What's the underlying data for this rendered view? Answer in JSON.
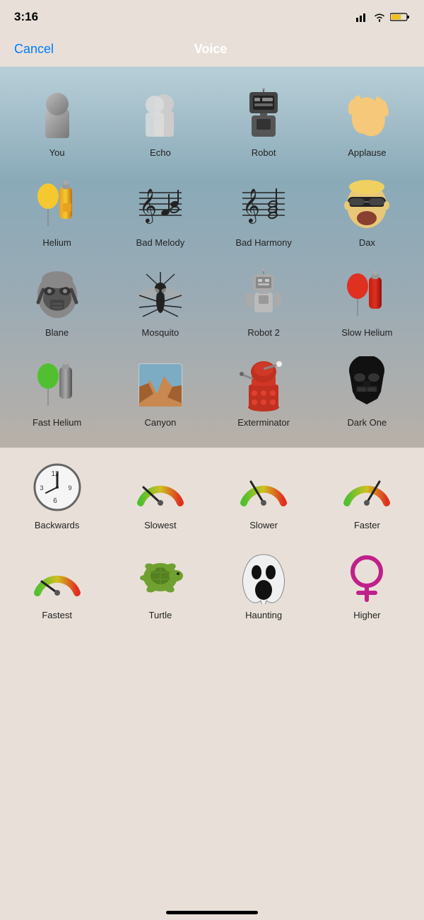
{
  "statusBar": {
    "time": "3:16",
    "signal": "▲▲▲",
    "wifi": "wifi",
    "battery": "battery"
  },
  "nav": {
    "cancel": "Cancel",
    "title": "Voice"
  },
  "voices": [
    {
      "id": "you",
      "label": "You",
      "icon": "person"
    },
    {
      "id": "echo",
      "label": "Echo",
      "icon": "echo"
    },
    {
      "id": "robot",
      "label": "Robot",
      "icon": "robot"
    },
    {
      "id": "applause",
      "label": "Applause",
      "icon": "applause"
    },
    {
      "id": "helium",
      "label": "Helium",
      "icon": "helium"
    },
    {
      "id": "bad-melody",
      "label": "Bad Melody",
      "icon": "badmelody"
    },
    {
      "id": "bad-harmony",
      "label": "Bad Harmony",
      "icon": "badharmony"
    },
    {
      "id": "dax",
      "label": "Dax",
      "icon": "dax"
    },
    {
      "id": "blane",
      "label": "Blane",
      "icon": "blane"
    },
    {
      "id": "mosquito",
      "label": "Mosquito",
      "icon": "mosquito"
    },
    {
      "id": "robot2",
      "label": "Robot 2",
      "icon": "robot2"
    },
    {
      "id": "slow-helium",
      "label": "Slow Helium",
      "icon": "slowhelium"
    },
    {
      "id": "fast-helium",
      "label": "Fast Helium",
      "icon": "fasthelium"
    },
    {
      "id": "canyon",
      "label": "Canyon",
      "icon": "canyon"
    },
    {
      "id": "exterminator",
      "label": "Exterminator",
      "icon": "exterminator"
    },
    {
      "id": "dark-one",
      "label": "Dark One",
      "icon": "darkone"
    },
    {
      "id": "backwards",
      "label": "Backwards",
      "icon": "backwards"
    },
    {
      "id": "slowest",
      "label": "Slowest",
      "icon": "slowest"
    },
    {
      "id": "slower",
      "label": "Slower",
      "icon": "slower"
    },
    {
      "id": "faster",
      "label": "Faster",
      "icon": "faster"
    },
    {
      "id": "fastest",
      "label": "Fastest",
      "icon": "fastest"
    },
    {
      "id": "turtle",
      "label": "Turtle",
      "icon": "turtle"
    },
    {
      "id": "haunting",
      "label": "Haunting",
      "icon": "haunting"
    },
    {
      "id": "higher",
      "label": "Higher",
      "icon": "higher"
    }
  ]
}
